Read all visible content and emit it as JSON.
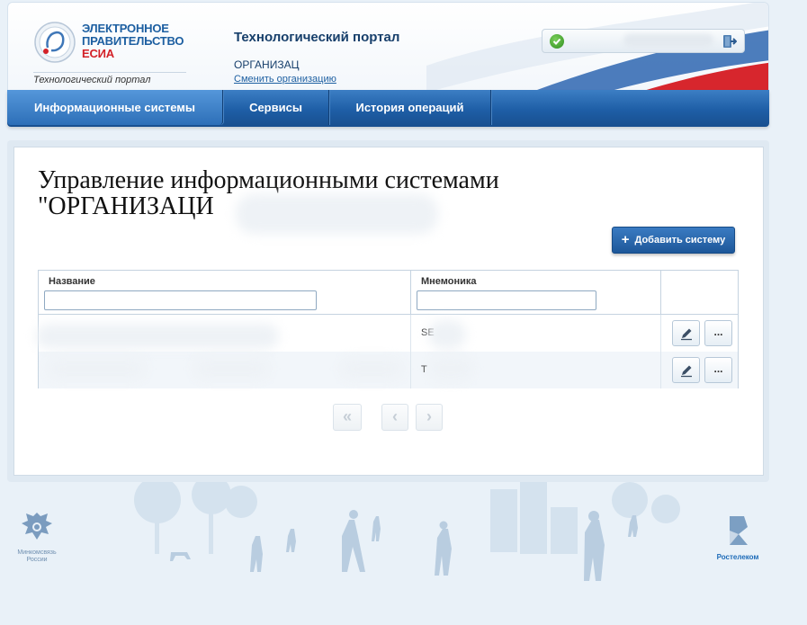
{
  "header": {
    "logo_line1": "ЭЛЕКТРОННОЕ",
    "logo_line2": "ПРАВИТЕЛЬСТВО",
    "logo_line3": "ЕСИА",
    "tagline": "Технологический портал",
    "portal_title": "Технологический портал",
    "org_name": "ОРГАНИЗАЦ",
    "change_org_link": "Сменить организацию",
    "status_icon": "check-icon",
    "logout_icon": "logout-icon"
  },
  "nav": {
    "items": [
      {
        "label": "Информационные системы",
        "active": true
      },
      {
        "label": "Сервисы",
        "active": false
      },
      {
        "label": "История операций",
        "active": false
      }
    ]
  },
  "main": {
    "title_line1": "Управление информационными системами",
    "title_line2": "\"ОРГАНИЗАЦИ",
    "add_button_label": "Добавить систему",
    "table": {
      "columns": [
        "Название",
        "Мнемоника",
        ""
      ],
      "filter_values": [
        "",
        ""
      ],
      "rows": [
        {
          "name": "",
          "mnemonic": "SE"
        },
        {
          "name": "",
          "mnemonic": "T"
        }
      ],
      "edit_icon": "pencil-icon",
      "more_label": "..."
    },
    "pagination": {
      "first": "«",
      "prev": "‹",
      "next": "›"
    }
  },
  "footer": {
    "left_logo_line1": "Минкомсвязь",
    "left_logo_line2": "России",
    "right_logo": "Ростелеком"
  },
  "colors": {
    "brand_blue": "#1e5ea6",
    "accent_red": "#d32027",
    "background": "#e9f1f8"
  }
}
